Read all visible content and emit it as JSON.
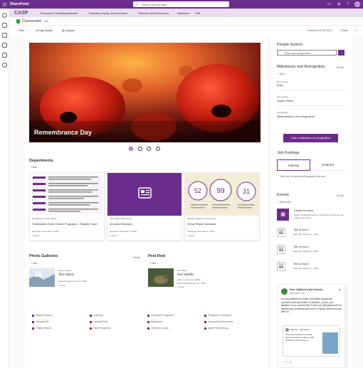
{
  "topbar": {
    "brand": "SharePoint",
    "search_placeholder": "Search across sites",
    "avatar": "DA"
  },
  "hubnav": {
    "logo": "CASP",
    "items": [
      "Employee Centre",
      "Departments",
      "Diversity, Equity, and Inclusion",
      "Services and Resources",
      "Initiatives",
      "Edit"
    ]
  },
  "site": {
    "title": "Connected",
    "edit": "Edit"
  },
  "commandbar": {
    "new": "New",
    "page_details": "Page details",
    "analytics": "Analytics",
    "published": "Published 12/12/2022",
    "edit": "Edit"
  },
  "hero": {
    "caption": "Remembrance Day",
    "slides": 4,
    "active_slide": 1
  },
  "departments": {
    "title": "Departments",
    "add": "Add",
    "cards": [
      {
        "category": "Employment Youth Centre",
        "title": "Trailblazers Youth Centre Programs - Register Now!",
        "author_date": "anonuser  November 9, 2022",
        "views": "1 views"
      },
      {
        "category": "Information Technology",
        "title": "All about Midware",
        "author_date": "anonuser  November 9, 2022",
        "views": "1 views"
      },
      {
        "category": "Diversity, Equity, and Inclusion",
        "title": "We.ar Report released",
        "author_date": "anonuser  November 9, 2022",
        "views": "1 views"
      }
    ],
    "poster_numbers": [
      "52",
      "99",
      "31"
    ]
  },
  "galleries": {
    "title": "Photo Galleries",
    "see_all": "See all",
    "add": "Add",
    "item": {
      "category": "Photo Gallery",
      "title": "Test Gallery",
      "author_date": "anonuser  November 22, 2022",
      "views": "1 views"
    }
  },
  "peelreel": {
    "title": "Peel Reel",
    "add": "Add",
    "item": {
      "category": "Peel Reel",
      "title": "Peel Wildlife",
      "desc": "Have a some fun wildlife...",
      "author_date": "anonuser  November 22, 2022",
      "views": "1 views"
    }
  },
  "people_search": {
    "title": "People Search",
    "placeholder": "Enter your search term..."
  },
  "milestones": {
    "title": "Milestones and Recognition",
    "see_all": "See all",
    "add": "Add",
    "rows": [
      {
        "label": "Recognition",
        "value": "Mark"
      },
      {
        "label": "Recognition",
        "value": "Shane Vieira"
      },
      {
        "label": "Recognition",
        "value": "Alicia wants to be recognized!"
      }
    ],
    "button": "Add a milestone or recognition!"
  },
  "jobs": {
    "title": "Job Postings",
    "tabs": [
      "Internal",
      "External"
    ],
    "empty": "There are no internal job postings at this time."
  },
  "events": {
    "title": "Events",
    "see_all": "See all",
    "add": "Add event",
    "create": {
      "title": "Create an event",
      "desc": "When you add an event, it will show here where your readers can see it."
    },
    "items": [
      {
        "month": "Month",
        "day": "01",
        "title": "Title of event",
        "sub": "Saturday, January 1, 2022"
      },
      {
        "month": "Month",
        "day": "01",
        "title": "Title of event",
        "sub": "Saturday, January 1, 2022"
      },
      {
        "month": "Month",
        "day": "01",
        "title": "Title of event",
        "sub": "Saturday, January 1, 2022"
      }
    ]
  },
  "tweet": {
    "name": "Peel Children's Aid Society",
    "handle": "@PeelCAS · 5h",
    "text": "So very grateful for these incredible @peelcas sponsors and advocates of children, youth, and families in our community! Thank you @Kaptionz05 for generously donating your time to inspire, lead and play with us",
    "quote_name": "Kaption... @Kaption...",
    "quote_text": "This past weekend, we were beyond excited to partner with Children's Aid Society fo..."
  },
  "footer": {
    "col1": [
      "People Search",
      "Canada 411",
      "Outlier Search"
    ],
    "col2": [
      "Learning",
      "Canada Post",
      "Food Programs"
    ],
    "col3": [
      "Employee Programs",
      "MapQuest",
      "Children's Laws"
    ],
    "col4": [
      "Programs & Services",
      "Community Resources",
      "www.PeelCAS.org"
    ]
  },
  "colors": {
    "brand": "#6b2d8c",
    "hubnav": "#e8def0",
    "accent_green": "#2ea043"
  }
}
